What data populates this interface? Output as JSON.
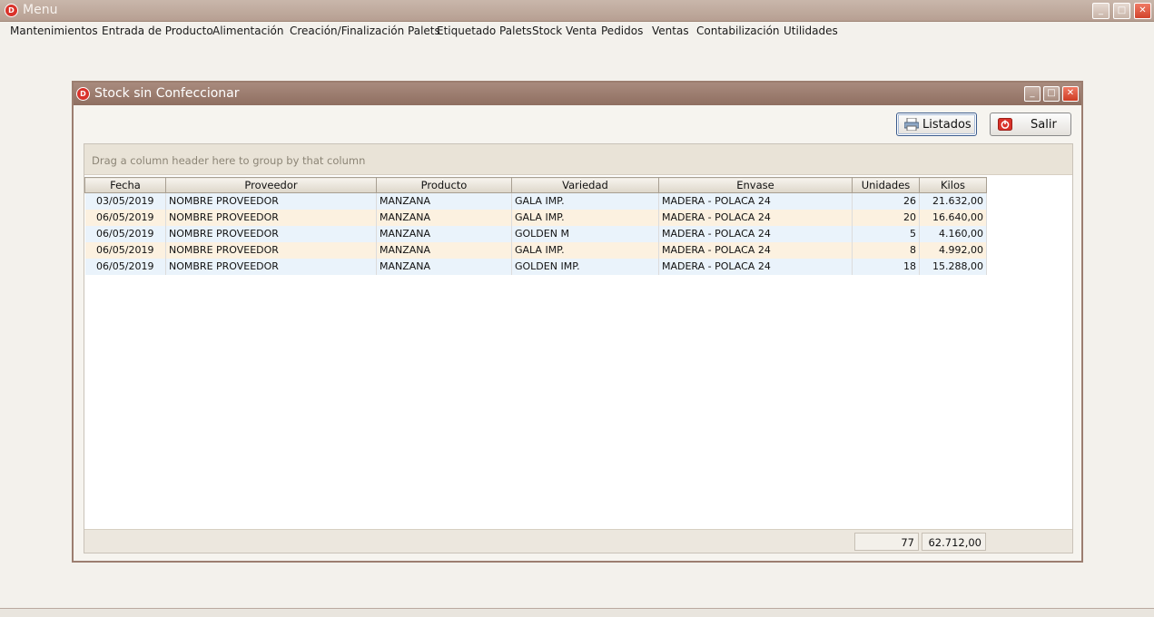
{
  "main_window": {
    "title": "Menu",
    "controls": {
      "minimize": "_",
      "maximize": "□",
      "close": "✕"
    }
  },
  "menu": [
    "Mantenimientos",
    "Entrada de Producto",
    "Alimentación",
    "Creación/Finalización Palets",
    "Etiquetado Palets",
    "Stock Venta",
    "Pedidos",
    "Ventas",
    "Contabilización",
    "Utilidades"
  ],
  "dialog": {
    "title": "Stock sin Confeccionar",
    "buttons": {
      "listados": "Listados",
      "salir": "Salir"
    },
    "group_panel_hint": "Drag a column header here to group by that column",
    "columns": [
      "Fecha",
      "Proveedor",
      "Producto",
      "Variedad",
      "Envase",
      "Unidades",
      "Kilos"
    ],
    "rows": [
      {
        "fecha": "03/05/2019",
        "proveedor": "NOMBRE PROVEEDOR",
        "producto": "MANZANA",
        "variedad": "GALA IMP.",
        "envase": "MADERA - POLACA 24",
        "unidades": "26",
        "kilos": "21.632,00"
      },
      {
        "fecha": "06/05/2019",
        "proveedor": "NOMBRE PROVEEDOR",
        "producto": "MANZANA",
        "variedad": "GALA IMP.",
        "envase": "MADERA - POLACA 24",
        "unidades": "20",
        "kilos": "16.640,00"
      },
      {
        "fecha": "06/05/2019",
        "proveedor": "NOMBRE PROVEEDOR",
        "producto": "MANZANA",
        "variedad": "GOLDEN M",
        "envase": "MADERA - POLACA 24",
        "unidades": "5",
        "kilos": "4.160,00"
      },
      {
        "fecha": "06/05/2019",
        "proveedor": "NOMBRE PROVEEDOR",
        "producto": "MANZANA",
        "variedad": "GALA IMP.",
        "envase": "MADERA - POLACA 24",
        "unidades": "8",
        "kilos": "4.992,00"
      },
      {
        "fecha": "06/05/2019",
        "proveedor": "NOMBRE PROVEEDOR",
        "producto": "MANZANA",
        "variedad": "GOLDEN IMP.",
        "envase": "MADERA - POLACA 24",
        "unidades": "18",
        "kilos": "15.288,00"
      }
    ],
    "totals": {
      "unidades": "77",
      "kilos": "62.712,00"
    }
  },
  "colors": {
    "title_bar": "#b79f92",
    "dialog_title_bar": "#8f6f61",
    "row_odd": "#eaf3fb",
    "row_even": "#fcf1e0",
    "close_button": "#d2432b"
  },
  "icons": {
    "app": "app-logo-icon",
    "listados": "printer-icon",
    "salir": "exit-icon"
  }
}
